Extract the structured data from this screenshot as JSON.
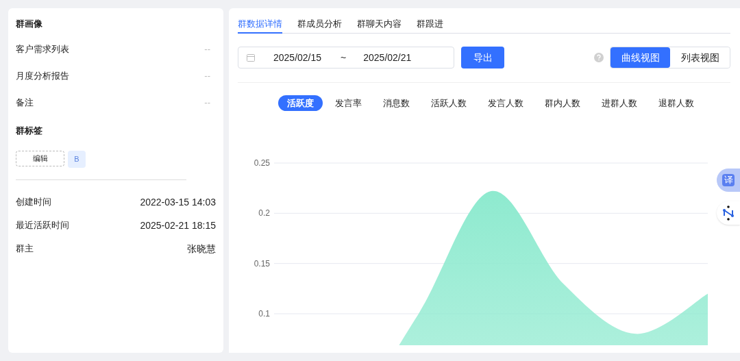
{
  "profile": {
    "title": "群画像",
    "fields": [
      {
        "label": "客户需求列表",
        "value": "--"
      },
      {
        "label": "月度分析报告",
        "value": "--"
      },
      {
        "label": "备注",
        "value": "--"
      }
    ],
    "tags_title": "群标签",
    "edit_button": "编辑",
    "tags": [
      "B"
    ],
    "info": [
      {
        "label": "创建时间",
        "value": "2022-03-15 14:03"
      },
      {
        "label": "最近活跃时间",
        "value": "2025-02-21 18:15"
      },
      {
        "label": "群主",
        "value": "张晓慧"
      }
    ]
  },
  "tabs": [
    {
      "label": "群数据详情",
      "selected": true
    },
    {
      "label": "群成员分析",
      "selected": false
    },
    {
      "label": "群聊天内容",
      "selected": false
    },
    {
      "label": "群跟进",
      "selected": false
    }
  ],
  "date_range": {
    "start": "2025/02/15",
    "separator": "~",
    "end": "2025/02/21"
  },
  "export_button": "导出",
  "views": [
    {
      "label": "曲线视图",
      "selected": true
    },
    {
      "label": "列表视图",
      "selected": false
    }
  ],
  "metrics": [
    {
      "label": "活跃度",
      "selected": true
    },
    {
      "label": "发言率",
      "selected": false
    },
    {
      "label": "消息数",
      "selected": false
    },
    {
      "label": "活跃人数",
      "selected": false
    },
    {
      "label": "发言人数",
      "selected": false
    },
    {
      "label": "群内人数",
      "selected": false
    },
    {
      "label": "进群人数",
      "selected": false
    },
    {
      "label": "退群人数",
      "selected": false
    }
  ],
  "chart": {
    "chart_data": {
      "type": "area",
      "grid": true,
      "ylim": [
        0,
        0.25
      ],
      "yticks": [
        {
          "value": 0.1,
          "label": "0.1"
        },
        {
          "value": 0.15,
          "label": "0.15"
        },
        {
          "value": 0.2,
          "label": "0.2"
        },
        {
          "value": 0.25,
          "label": "0.25"
        }
      ],
      "series": [
        {
          "color": "#8eeacf",
          "values": [
            0,
            0,
            0.1,
            0.222,
            0.13,
            0.08,
            0.12
          ]
        }
      ]
    }
  },
  "floating_tools": [
    {
      "kind": "translate",
      "label": "译"
    },
    {
      "kind": "network"
    }
  ]
}
